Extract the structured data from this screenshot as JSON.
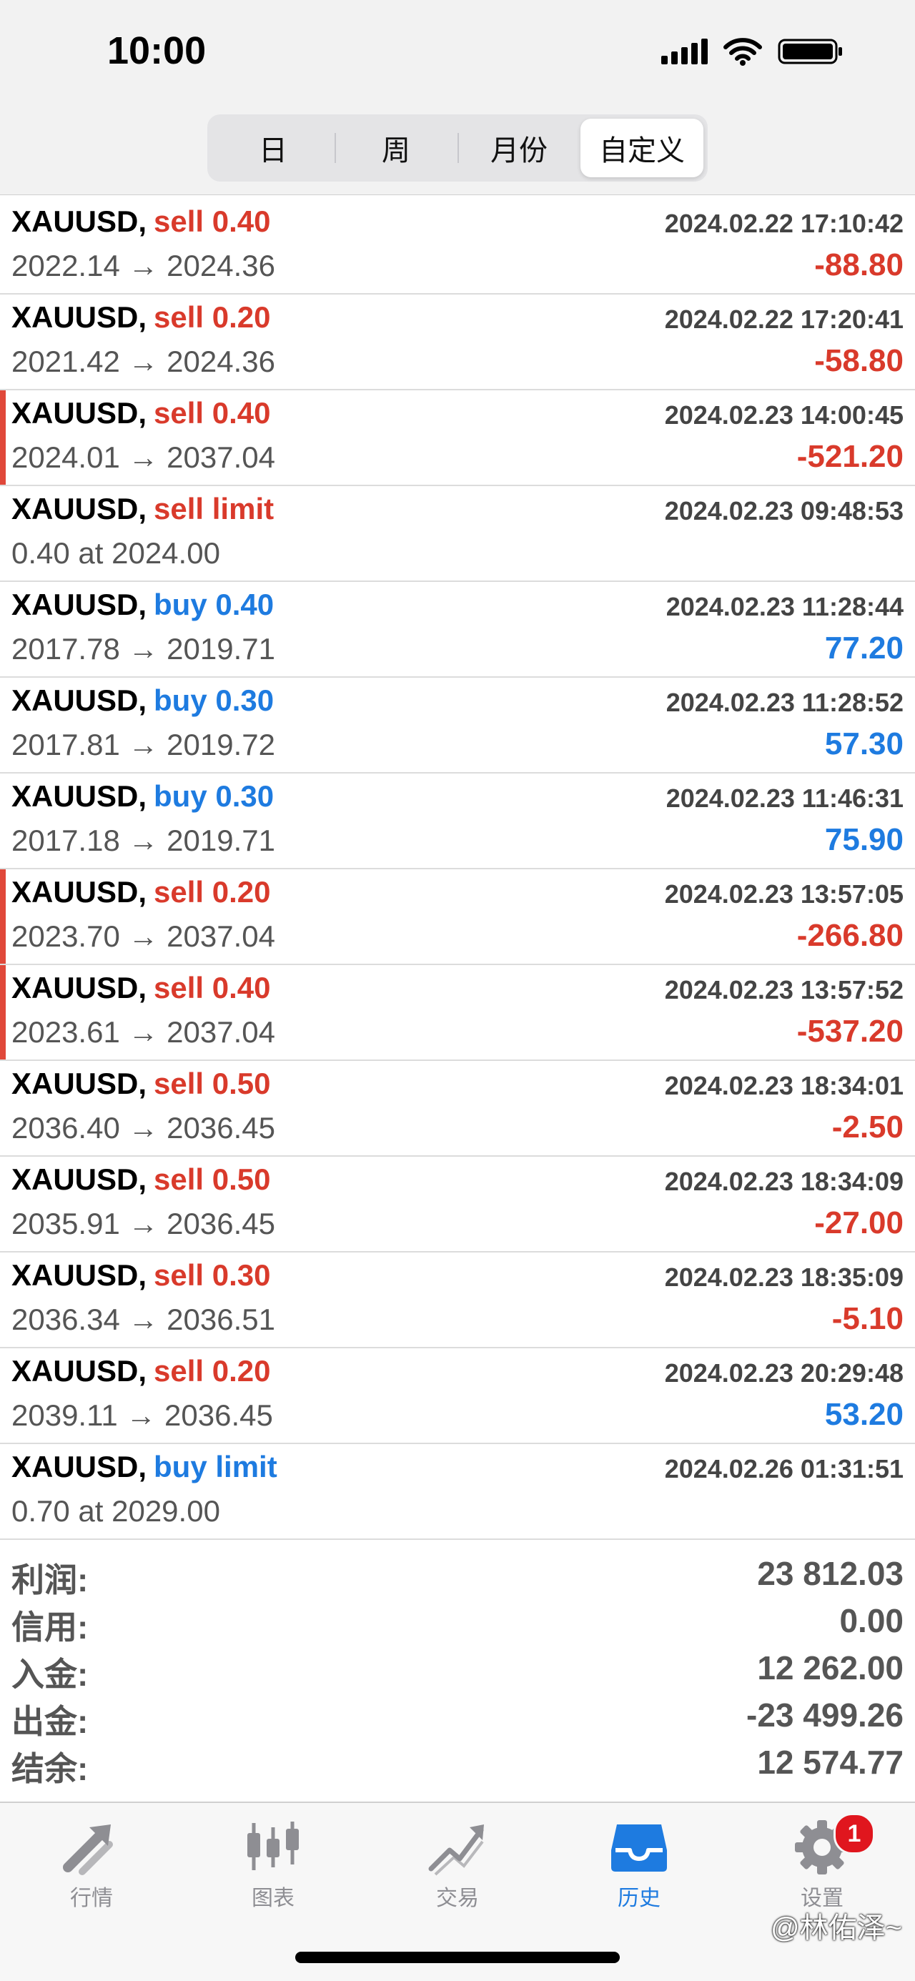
{
  "status_bar": {
    "time": "10:00"
  },
  "period_tabs": [
    {
      "label": "日",
      "active": false
    },
    {
      "label": "周",
      "active": false
    },
    {
      "label": "月份",
      "active": false
    },
    {
      "label": "自定义",
      "active": true
    }
  ],
  "trades": [
    {
      "symbol": "XAUUSD,",
      "side": "sell 0.40",
      "type": "sell",
      "time": "2024.02.22 17:10:42",
      "detail": "2022.14 → 2024.36",
      "profit": "-88.80",
      "flag": false
    },
    {
      "symbol": "XAUUSD,",
      "side": "sell 0.20",
      "type": "sell",
      "time": "2024.02.22 17:20:41",
      "detail": "2021.42 → 2024.36",
      "profit": "-58.80",
      "flag": false
    },
    {
      "symbol": "XAUUSD,",
      "side": "sell 0.40",
      "type": "sell",
      "time": "2024.02.23 14:00:45",
      "detail": "2024.01 → 2037.04",
      "profit": "-521.20",
      "flag": true
    },
    {
      "symbol": "XAUUSD,",
      "side": "sell limit",
      "type": "sell",
      "time": "2024.02.23 09:48:53",
      "detail": "0.40 at 2024.00",
      "profit": "",
      "flag": false
    },
    {
      "symbol": "XAUUSD,",
      "side": "buy 0.40",
      "type": "buy",
      "time": "2024.02.23 11:28:44",
      "detail": "2017.78 → 2019.71",
      "profit": "77.20",
      "flag": false
    },
    {
      "symbol": "XAUUSD,",
      "side": "buy 0.30",
      "type": "buy",
      "time": "2024.02.23 11:28:52",
      "detail": "2017.81 → 2019.72",
      "profit": "57.30",
      "flag": false
    },
    {
      "symbol": "XAUUSD,",
      "side": "buy 0.30",
      "type": "buy",
      "time": "2024.02.23 11:46:31",
      "detail": "2017.18 → 2019.71",
      "profit": "75.90",
      "flag": false
    },
    {
      "symbol": "XAUUSD,",
      "side": "sell 0.20",
      "type": "sell",
      "time": "2024.02.23 13:57:05",
      "detail": "2023.70 → 2037.04",
      "profit": "-266.80",
      "flag": true
    },
    {
      "symbol": "XAUUSD,",
      "side": "sell 0.40",
      "type": "sell",
      "time": "2024.02.23 13:57:52",
      "detail": "2023.61 → 2037.04",
      "profit": "-537.20",
      "flag": true
    },
    {
      "symbol": "XAUUSD,",
      "side": "sell 0.50",
      "type": "sell",
      "time": "2024.02.23 18:34:01",
      "detail": "2036.40 → 2036.45",
      "profit": "-2.50",
      "flag": false
    },
    {
      "symbol": "XAUUSD,",
      "side": "sell 0.50",
      "type": "sell",
      "time": "2024.02.23 18:34:09",
      "detail": "2035.91 → 2036.45",
      "profit": "-27.00",
      "flag": false
    },
    {
      "symbol": "XAUUSD,",
      "side": "sell 0.30",
      "type": "sell",
      "time": "2024.02.23 18:35:09",
      "detail": "2036.34 → 2036.51",
      "profit": "-5.10",
      "flag": false
    },
    {
      "symbol": "XAUUSD,",
      "side": "sell 0.20",
      "type": "sell",
      "time": "2024.02.23 20:29:48",
      "detail": "2039.11 → 2036.45",
      "profit": "53.20",
      "flag": false
    },
    {
      "symbol": "XAUUSD,",
      "side": "buy limit",
      "type": "buy",
      "time": "2024.02.26 01:31:51",
      "detail": "0.70 at 2029.00",
      "profit": "",
      "flag": false
    }
  ],
  "summary": [
    {
      "label": "利润:",
      "value": "23 812.03"
    },
    {
      "label": "信用:",
      "value": "0.00"
    },
    {
      "label": "入金:",
      "value": "12 262.00"
    },
    {
      "label": "出金:",
      "value": "-23 499.26"
    },
    {
      "label": "结余:",
      "value": "12 574.77"
    }
  ],
  "tab_bar": [
    {
      "label": "行情",
      "icon": "quotes-arrows-icon",
      "active": false
    },
    {
      "label": "图表",
      "icon": "candlestick-chart-icon",
      "active": false
    },
    {
      "label": "交易",
      "icon": "trade-chart-icon",
      "active": false
    },
    {
      "label": "历史",
      "icon": "history-inbox-icon",
      "active": true
    },
    {
      "label": "设置",
      "icon": "gear-icon",
      "active": false,
      "badge": "1"
    }
  ],
  "watermark": "@林佑泽~",
  "colors": {
    "sell": "#d93a2b",
    "buy": "#1e7be0",
    "active_tab": "#1e7be0",
    "loss_flag": "#e0483a",
    "badge": "#e0161e"
  }
}
